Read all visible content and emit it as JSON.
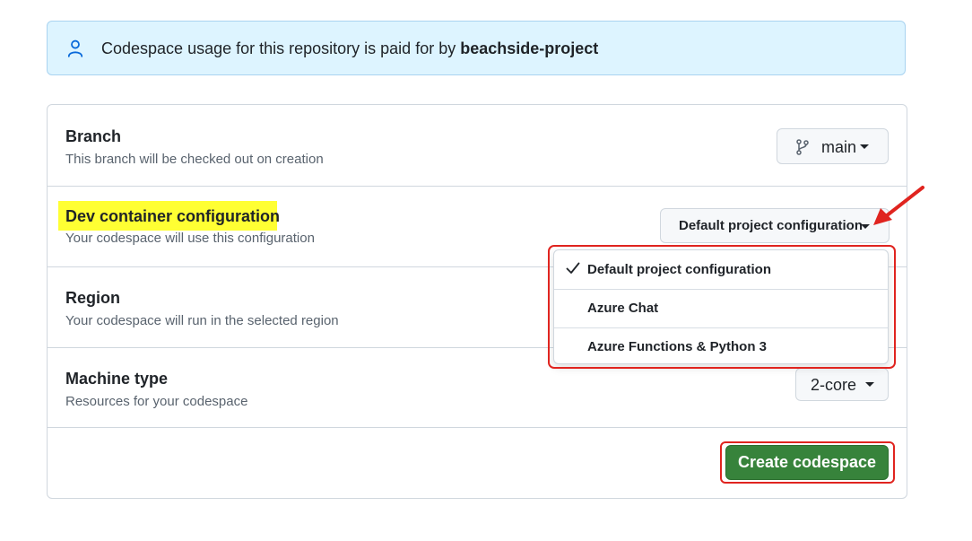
{
  "banner": {
    "icon": "person-icon",
    "text_prefix": "Codespace usage for this repository is paid for by ",
    "text_bold": "beachside-project"
  },
  "branch": {
    "title": "Branch",
    "description": "This branch will be checked out on creation",
    "button_label": "main",
    "icon": "git-branch-icon"
  },
  "dev_container": {
    "title": "Dev container configuration",
    "description": "Your codespace will use this configuration",
    "button_label": "Default project configuration",
    "highlight_color": "#ffff33",
    "menu": {
      "selected_index": 0,
      "options": [
        "Default project configuration",
        "Azure Chat",
        "Azure Functions & Python 3"
      ]
    }
  },
  "region": {
    "title": "Region",
    "description": "Your codespace will run in the selected region"
  },
  "machine_type": {
    "title": "Machine type",
    "description": "Resources for your codespace",
    "button_label": "2-core"
  },
  "actions": {
    "create_label": "Create codespace",
    "create_color": "#37833b"
  },
  "annotations": {
    "color": "#e0241f"
  }
}
